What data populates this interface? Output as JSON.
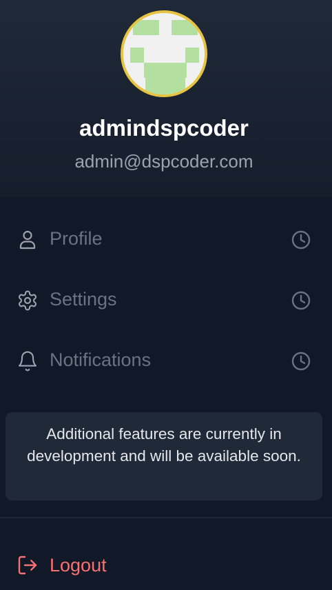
{
  "user": {
    "name": "admindspcoder",
    "email": "admin@dspcoder.com",
    "avatar_border_color": "#e6c340",
    "avatar_pattern_color": "#b3dfa0"
  },
  "menu": {
    "items": [
      {
        "label": "Profile",
        "icon": "user-icon",
        "status_icon": "clock-icon"
      },
      {
        "label": "Settings",
        "icon": "gear-icon",
        "status_icon": "clock-icon"
      },
      {
        "label": "Notifications",
        "icon": "bell-icon",
        "status_icon": "clock-icon"
      }
    ]
  },
  "notice": {
    "text": "Additional features are currently in development and will be available soon."
  },
  "logout": {
    "label": "Logout",
    "icon": "logout-icon",
    "color": "#f87171"
  }
}
